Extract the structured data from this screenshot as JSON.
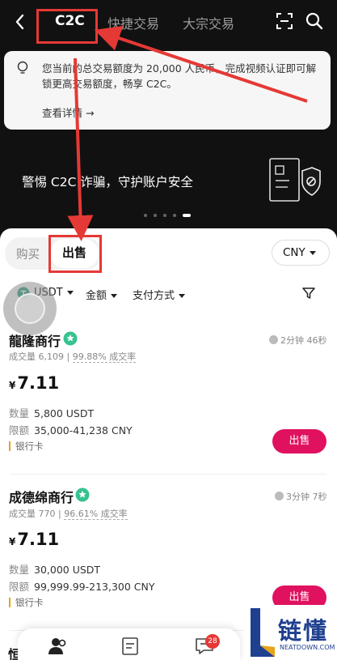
{
  "header": {
    "tabs": [
      "C2C",
      "快捷交易",
      "大宗交易"
    ],
    "active_tab": "C2C"
  },
  "notice": {
    "text": "您当前的总交易额度为 20,000 人民币，完成视频认证即可解锁更高交易额度，畅享 C2C。",
    "link": "查看详情 →"
  },
  "banner": {
    "text": "警惕 C2C 诈骗，守护账户安全",
    "slides": 5,
    "active_slide": 5
  },
  "trade_mode": {
    "buy": "购买",
    "sell": "出售",
    "active": "出售"
  },
  "currency": "CNY",
  "filters": {
    "coin": "USDT",
    "amount": "金额",
    "payment": "支付方式"
  },
  "offers": [
    {
      "merchant": "龍隆商行",
      "volume": "成交量 6,109",
      "rate": "99.88% 成交率",
      "time": "2分钟 46秒",
      "currency_symbol": "¥",
      "price": "7.11",
      "qty_label": "数量",
      "qty": "5,800 USDT",
      "limit_label": "限额",
      "limit": "35,000-41,238 CNY",
      "payment": "银行卡",
      "button": "出售"
    },
    {
      "merchant": "成德绵商行",
      "volume": "成交量 770",
      "rate": "96.61% 成交率",
      "time": "3分钟 7秒",
      "currency_symbol": "¥",
      "price": "7.11",
      "qty_label": "数量",
      "qty": "30,000 USDT",
      "limit_label": "限额",
      "limit": "99,999.99-213,300 CNY",
      "payment": "银行卡",
      "button": "出售"
    }
  ],
  "next_merchant_partial": "恒",
  "bottom_nav": {
    "message_badge": "28"
  },
  "watermark": {
    "text": "链懂",
    "domain": "NEATDOWN.COM"
  },
  "colors": {
    "accent": "#e0115f",
    "annotation": "#e53935",
    "verified": "#35c38f",
    "watermark": "#1f3f8f"
  }
}
